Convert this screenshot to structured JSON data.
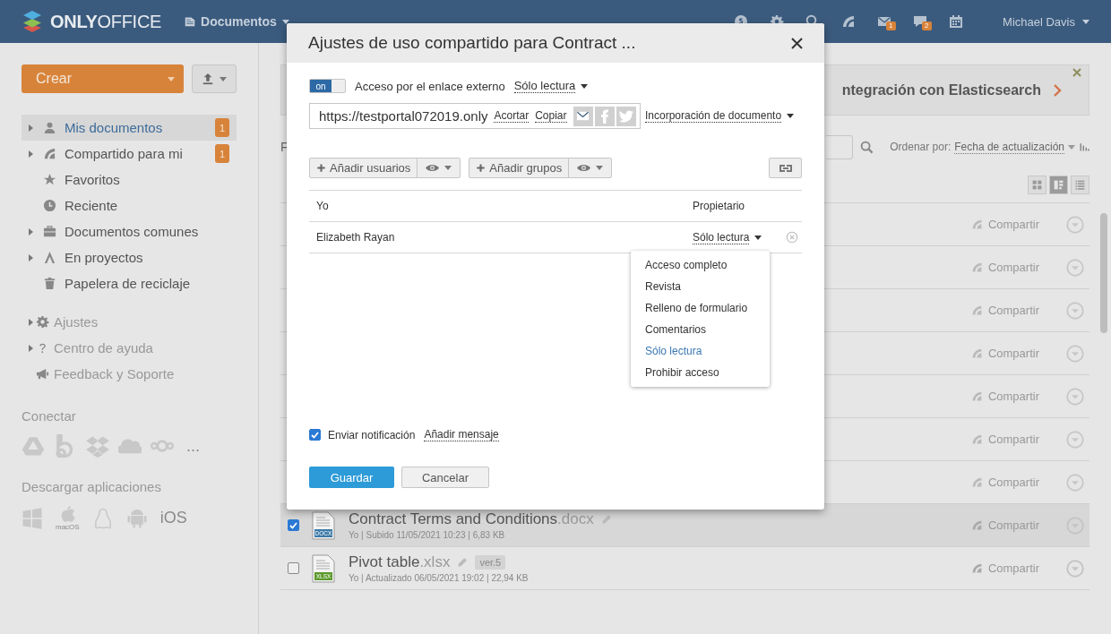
{
  "header": {
    "logo": "**ONLY**OFFICE",
    "module": "Documentos",
    "icons": [
      {
        "kind": "coin"
      },
      {
        "kind": "settings"
      },
      {
        "kind": "search"
      },
      {
        "kind": "feed"
      },
      {
        "kind": "mail",
        "badge": "1"
      },
      {
        "kind": "chat",
        "badge": "2"
      },
      {
        "kind": "calendar"
      }
    ],
    "user": "Michael Davis"
  },
  "sidebar": {
    "create_button": "Crear",
    "nav": [
      {
        "label": "Mis documentos",
        "kind": "person",
        "expandable": true,
        "selected": true,
        "badge": "1"
      },
      {
        "label": "Compartido para mi",
        "kind": "feed",
        "expandable": true,
        "selected": false,
        "badge": "1"
      },
      {
        "label": "Favoritos",
        "kind": "star",
        "expandable": false,
        "selected": false
      },
      {
        "label": "Reciente",
        "kind": "clock",
        "expandable": false,
        "selected": false
      },
      {
        "label": "Documentos comunes",
        "kind": "briefcase",
        "expandable": true,
        "selected": false
      },
      {
        "label": "En proyectos",
        "kind": "compass",
        "expandable": true,
        "selected": false
      },
      {
        "label": "Papelera de reciclaje",
        "kind": "trash",
        "expandable": false,
        "selected": false
      }
    ],
    "secondary": [
      {
        "label": "Ajustes",
        "kind": "gear",
        "expandable": true
      },
      {
        "label": "Centro de ayuda",
        "kind": "question",
        "expandable": true
      },
      {
        "label": "Feedback y Soporte",
        "kind": "megaphone",
        "expandable": false
      }
    ],
    "connect": {
      "title": "Conectar",
      "services": [
        {
          "kind": "drive"
        },
        {
          "kind": "box"
        },
        {
          "kind": "dropbox"
        },
        {
          "kind": "onedrive"
        },
        {
          "kind": "nextcloud"
        }
      ],
      "more": "..."
    },
    "apps": {
      "title": "Descargar aplicaciones",
      "items": [
        {
          "kind": "windows"
        },
        {
          "kind": "apple",
          "label": "macOS"
        },
        {
          "kind": "linux"
        },
        {
          "kind": "android"
        },
        {
          "kind": "text",
          "label": "iOS"
        }
      ]
    }
  },
  "main": {
    "banner": {
      "text": "ntegración con Elasticsearch"
    },
    "filter_label": "F",
    "sort": {
      "label": "Ordenar por:",
      "value": "Fecha de actualización"
    },
    "view_modes": [
      {
        "kind": "tiles",
        "selected": false
      },
      {
        "kind": "compact",
        "selected": true
      },
      {
        "kind": "list",
        "selected": false
      }
    ],
    "files": [
      {
        "kind": "covered",
        "share": "Compartir"
      },
      {
        "kind": "covered",
        "share": "Compartir"
      },
      {
        "kind": "covered",
        "share": "Compartir"
      },
      {
        "kind": "covered",
        "share": "Compartir"
      },
      {
        "kind": "covered",
        "share": "Compartir"
      },
      {
        "kind": "covered",
        "share": "Compartir"
      },
      {
        "kind": "covered",
        "share": "Compartir"
      },
      {
        "kind": "file",
        "checked": true,
        "selected": true,
        "name": "Contract Terms and Conditions",
        "ext": ".docx",
        "type": "DOCX",
        "color": "#3d7aa8",
        "meta": "Yo | Subido 11/05/2021 10:23 | 6,83 KB",
        "share": "Compartir"
      },
      {
        "kind": "file",
        "checked": false,
        "selected": false,
        "name": "Pivot table",
        "ext": ".xlsx",
        "type": "XLSX",
        "color": "#5c9a2c",
        "version": "ver.5",
        "meta": "Yo | Actualizado 06/05/2021 19:02 | 22,94 KB",
        "share": "Compartir"
      }
    ]
  },
  "dialog": {
    "title": "Ajustes de uso compartido para Contract ...",
    "external_link": {
      "on": true,
      "toggle_label": "on",
      "label": "Acceso por el enlace externo",
      "access": "Sólo lectura"
    },
    "url": "https://testportal072019.only",
    "shorten": "Acortar",
    "copy": "Copiar",
    "embed": "Incorporación de documento",
    "add_users": "Añadir usuarios",
    "add_groups": "Añadir grupos",
    "shares": [
      {
        "name": "Yo",
        "access": "Propietario",
        "kind": "owner"
      },
      {
        "name": "Elizabeth Rayan",
        "access": "Sólo lectura",
        "kind": "editable"
      }
    ],
    "access_menu": [
      {
        "label": "Acceso completo",
        "selected": false
      },
      {
        "label": "Revista",
        "selected": false
      },
      {
        "label": "Relleno de formulario",
        "selected": false
      },
      {
        "label": "Comentarios",
        "selected": false
      },
      {
        "label": "Sólo lectura",
        "selected": true
      },
      {
        "label": "Prohibir acceso",
        "selected": false
      }
    ],
    "notify": {
      "checked": true,
      "label": "Enviar notificación"
    },
    "add_message": "Añadir mensaje",
    "save": "Guardar",
    "cancel": "Cancelar"
  }
}
